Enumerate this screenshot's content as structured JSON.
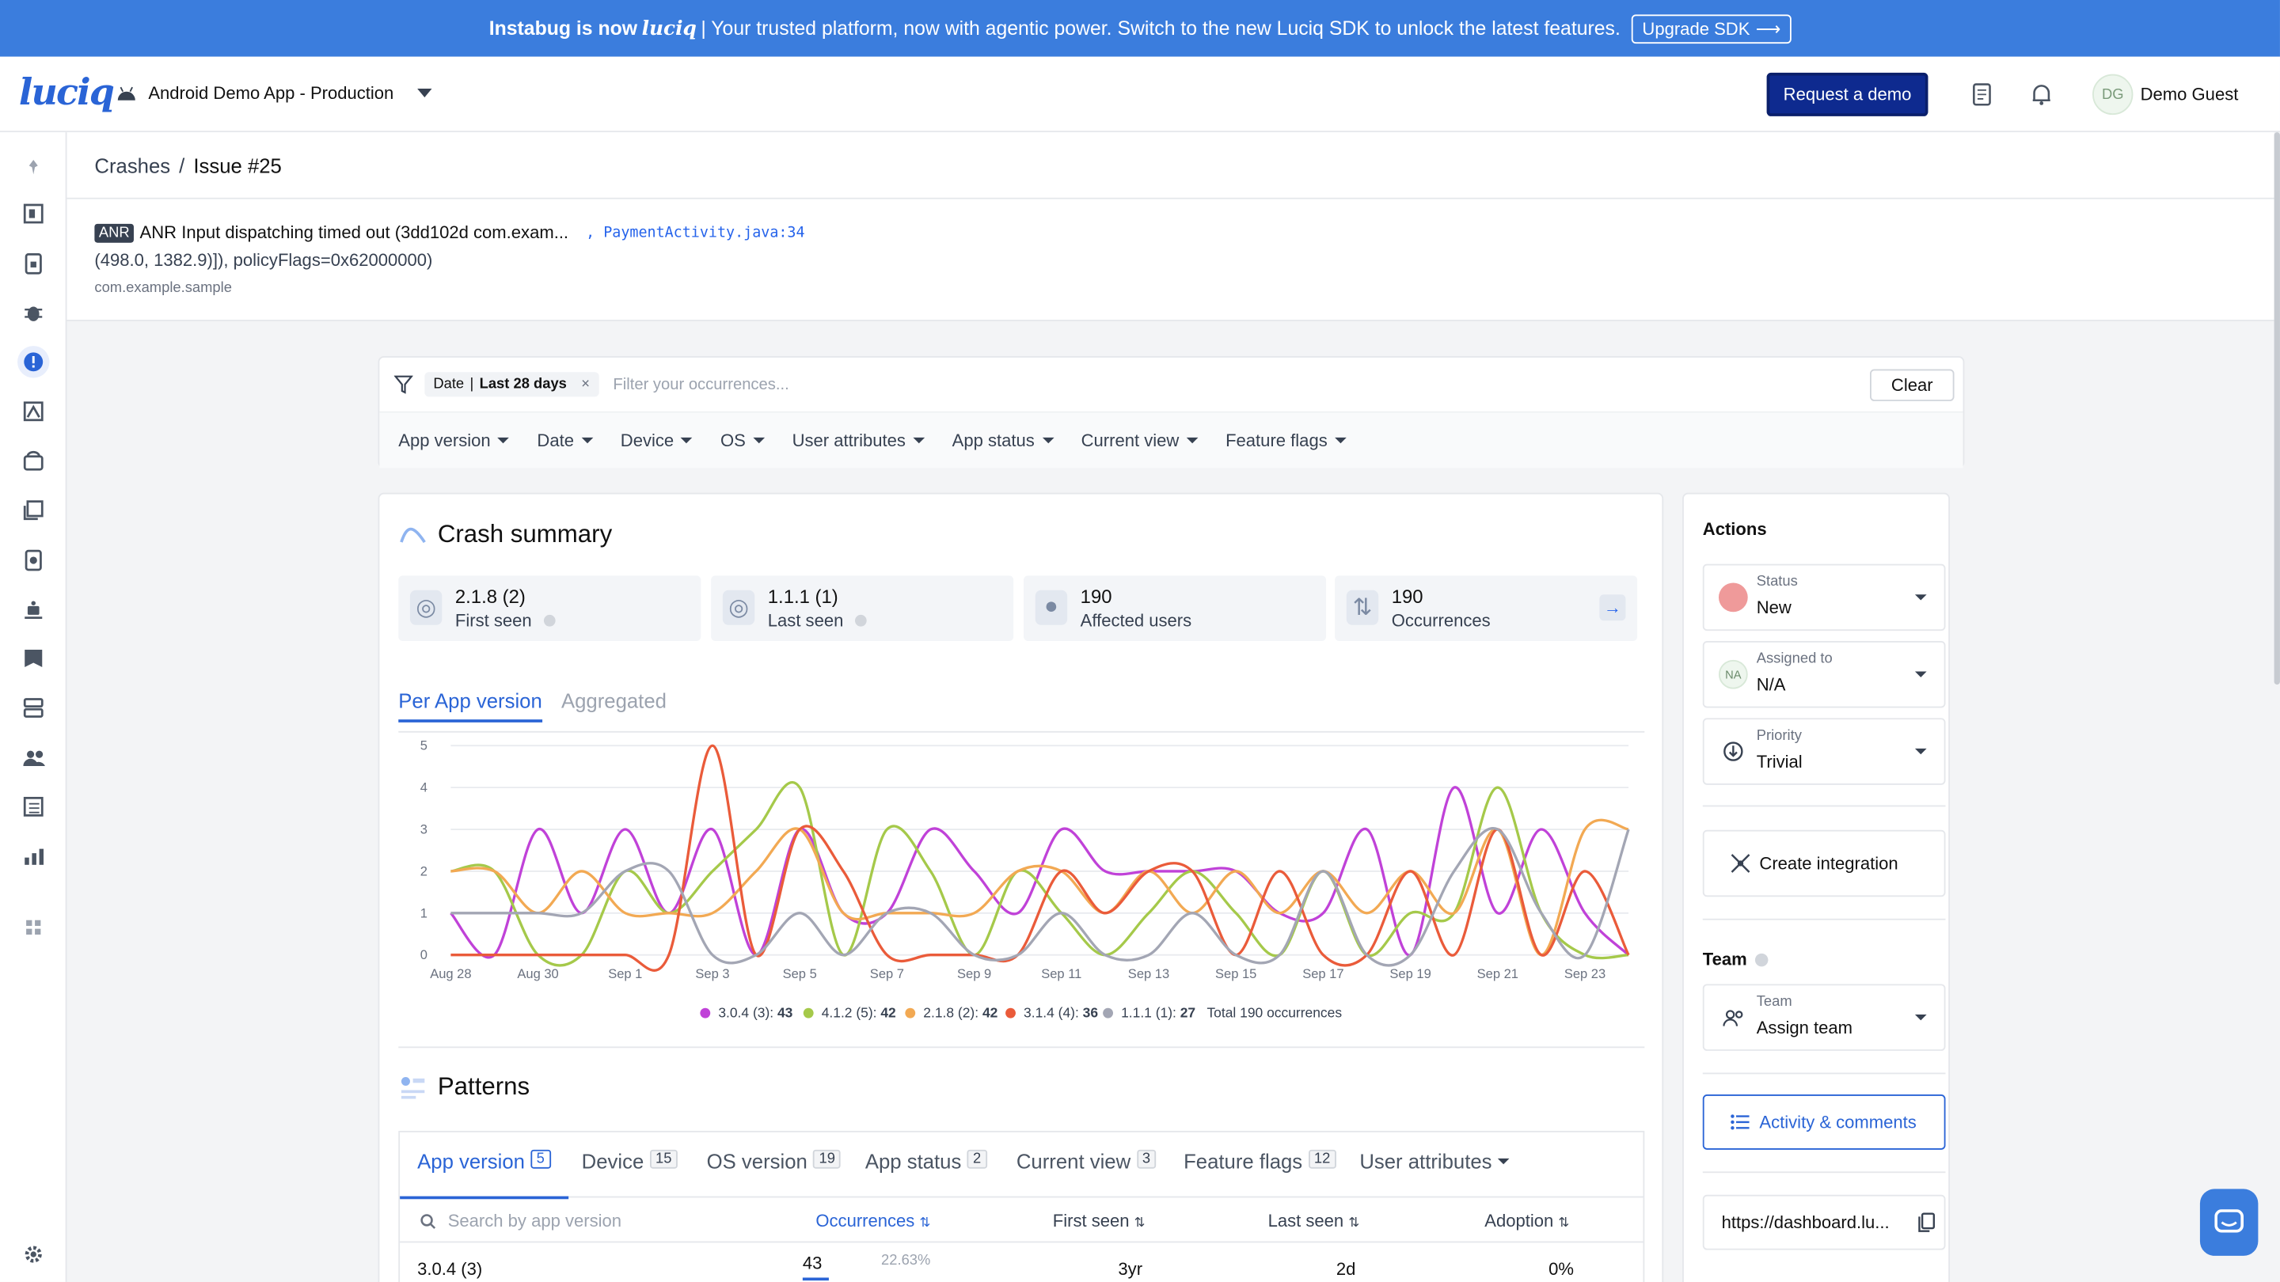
{
  "banner": {
    "brand": "Instabug is now",
    "logo": "luciq",
    "text": "| Your trusted platform, now with agentic power. Switch to the new Luciq SDK to unlock the latest features.",
    "button": "Upgrade SDK"
  },
  "topbar": {
    "logo": "luciq",
    "app": "Android Demo App - Production",
    "request_demo": "Request a demo",
    "avatar": "DG",
    "user": "Demo Guest"
  },
  "breadcrumb": {
    "parent": "Crashes",
    "sep": "/",
    "current": "Issue #25"
  },
  "issue": {
    "badge": "ANR",
    "title": "ANR Input dispatching timed out (3dd102d com.exam...",
    "location": ", PaymentActivity.java:34",
    "line2": "(498.0, 1382.9)]), policyFlags=0x62000000)",
    "package": "com.example.sample"
  },
  "filter": {
    "chip_label": "Date",
    "chip_sep": "|",
    "chip_value": "Last 28 days",
    "chip_close": "×",
    "placeholder": "Filter your occurrences...",
    "clear": "Clear",
    "dropdowns": [
      "App version",
      "Date",
      "Device",
      "OS",
      "User attributes",
      "App status",
      "Current view",
      "Feature flags"
    ]
  },
  "summary": {
    "title": "Crash summary",
    "stats": [
      {
        "value": "2.1.8 (2)",
        "label": "First seen"
      },
      {
        "value": "1.1.1 (1)",
        "label": "Last seen"
      },
      {
        "value": "190",
        "label": "Affected users"
      },
      {
        "value": "190",
        "label": "Occurrences"
      }
    ],
    "tabs": [
      "Per App version",
      "Aggregated"
    ]
  },
  "chart_data": {
    "type": "line",
    "x": [
      "Aug 28",
      "Aug 29",
      "Aug 30",
      "Aug 31",
      "Sep 1",
      "Sep 2",
      "Sep 3",
      "Sep 4",
      "Sep 5",
      "Sep 6",
      "Sep 7",
      "Sep 8",
      "Sep 9",
      "Sep 10",
      "Sep 11",
      "Sep 12",
      "Sep 13",
      "Sep 14",
      "Sep 15",
      "Sep 16",
      "Sep 17",
      "Sep 18",
      "Sep 19",
      "Sep 20",
      "Sep 21",
      "Sep 22",
      "Sep 23",
      "Sep 24"
    ],
    "x_tick_labels": [
      "Aug 28",
      "Aug 30",
      "Sep 1",
      "Sep 3",
      "Sep 5",
      "Sep 7",
      "Sep 9",
      "Sep 11",
      "Sep 13",
      "Sep 15",
      "Sep 17",
      "Sep 19",
      "Sep 21",
      "Sep 23"
    ],
    "ylim": [
      0,
      5
    ],
    "yticks": [
      0,
      1,
      2,
      3,
      4,
      5
    ],
    "grid": true,
    "legend_position": "bottom",
    "series": [
      {
        "name": "3.0.4 (3):",
        "total": "43",
        "color": "#c042d8",
        "values": [
          1,
          0,
          3,
          1,
          3,
          1,
          3,
          0,
          3,
          1,
          1,
          3,
          2,
          1,
          3,
          2,
          2,
          2,
          2,
          1,
          1,
          3,
          0,
          4,
          1,
          3,
          1,
          0
        ]
      },
      {
        "name": "4.1.2 (5):",
        "total": "42",
        "color": "#a5c94a",
        "values": [
          2,
          2,
          0,
          0,
          2,
          1,
          2,
          3,
          4,
          0,
          3,
          2,
          0,
          2,
          1,
          0,
          1,
          2,
          1,
          0,
          2,
          0,
          1,
          1,
          4,
          1,
          0,
          0
        ]
      },
      {
        "name": "2.1.8 (2):",
        "total": "42",
        "color": "#f2a953",
        "values": [
          2,
          2,
          1,
          2,
          1,
          1,
          1,
          2,
          3,
          1,
          1,
          1,
          1,
          2,
          2,
          1,
          2,
          1,
          2,
          1,
          2,
          1,
          2,
          1,
          3,
          0,
          3,
          3
        ]
      },
      {
        "name": "3.1.4 (4):",
        "total": "36",
        "color": "#ea5b3a",
        "values": [
          0,
          0,
          0,
          0,
          0,
          0,
          5,
          0,
          3,
          2,
          0,
          0,
          0,
          0,
          2,
          1,
          2,
          2,
          0,
          2,
          0,
          0,
          2,
          0,
          3,
          0,
          2,
          0
        ]
      },
      {
        "name": "1.1.1 (1):",
        "total": "27",
        "color": "#a3a6b4",
        "values": [
          1,
          1,
          1,
          1,
          2,
          2,
          0,
          0,
          1,
          0,
          1,
          1,
          0,
          0,
          1,
          0,
          0,
          1,
          0,
          0,
          2,
          0,
          0,
          2,
          3,
          1,
          0,
          3
        ]
      }
    ],
    "total_label": "Total 190 occurrences"
  },
  "patterns": {
    "title": "Patterns",
    "tabs": [
      {
        "label": "App version",
        "count": "5"
      },
      {
        "label": "Device",
        "count": "15"
      },
      {
        "label": "OS version",
        "count": "19"
      },
      {
        "label": "App status",
        "count": "2"
      },
      {
        "label": "Current view",
        "count": "3"
      },
      {
        "label": "Feature flags",
        "count": "12"
      },
      {
        "label": "User attributes",
        "count": ""
      }
    ],
    "search_placeholder": "Search by app version",
    "columns": [
      "Occurrences",
      "First seen",
      "Last seen",
      "Adoption"
    ],
    "row": {
      "version": "3.0.4 (3)",
      "occurrences": "43",
      "percent": "22.63%",
      "first_seen": "3yr",
      "last_seen": "2d",
      "adoption": "0%"
    }
  },
  "actions": {
    "title": "Actions",
    "status_key": "Status",
    "status_val": "New",
    "assigned_key": "Assigned to",
    "assigned_val": "N/A",
    "assigned_avatar": "NA",
    "priority_key": "Priority",
    "priority_val": "Trivial",
    "create_integration": "Create integration",
    "team_title": "Team",
    "team_key": "Team",
    "team_val": "Assign team",
    "activity": "Activity & comments",
    "link": "https://dashboard.lu..."
  },
  "colors": {
    "accent": "#2a64d6",
    "banner": "#3b7ddd",
    "primary_button": "#0e2a8f",
    "status_new": "#ef9a9a"
  }
}
